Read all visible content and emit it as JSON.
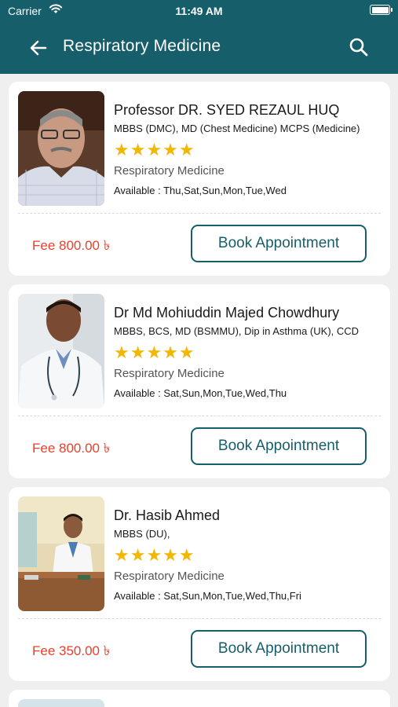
{
  "status_bar": {
    "carrier": "Carrier",
    "time": "11:49 AM"
  },
  "app_bar": {
    "title": "Respiratory Medicine",
    "back_icon": "arrow-left-icon",
    "search_icon": "search-icon"
  },
  "colors": {
    "primary": "#175e6b",
    "fee": "#e5412d",
    "star": "#f2b705",
    "background": "#efefef"
  },
  "doctors": [
    {
      "name": "Professor DR. SYED REZAUL HUQ",
      "degree": "MBBS (DMC), MD (Chest Medicine) MCPS (Medicine)",
      "rating": 5,
      "stars": "★★★★★",
      "specialty": "Respiratory Medicine",
      "available": "Available : Thu,Sat,Sun,Mon,Tue,Wed",
      "fee": "Fee 800.00 ৳",
      "button": "Book Appointment"
    },
    {
      "name": "Dr Md Mohiuddin Majed Chowdhury",
      "degree": "MBBS, BCS, MD (BSMMU), Dip in Asthma (UK), CCD",
      "rating": 5,
      "stars": "★★★★★",
      "specialty": "Respiratory Medicine",
      "available": "Available : Sat,Sun,Mon,Tue,Wed,Thu",
      "fee": "Fee 800.00 ৳",
      "button": "Book Appointment"
    },
    {
      "name": "Dr. Hasib Ahmed",
      "degree": "MBBS (DU),",
      "rating": 5,
      "stars": "★★★★★",
      "specialty": "Respiratory Medicine",
      "available": "Available : Sat,Sun,Mon,Tue,Wed,Thu,Fri",
      "fee": "Fee 350.00 ৳",
      "button": "Book Appointment"
    }
  ]
}
